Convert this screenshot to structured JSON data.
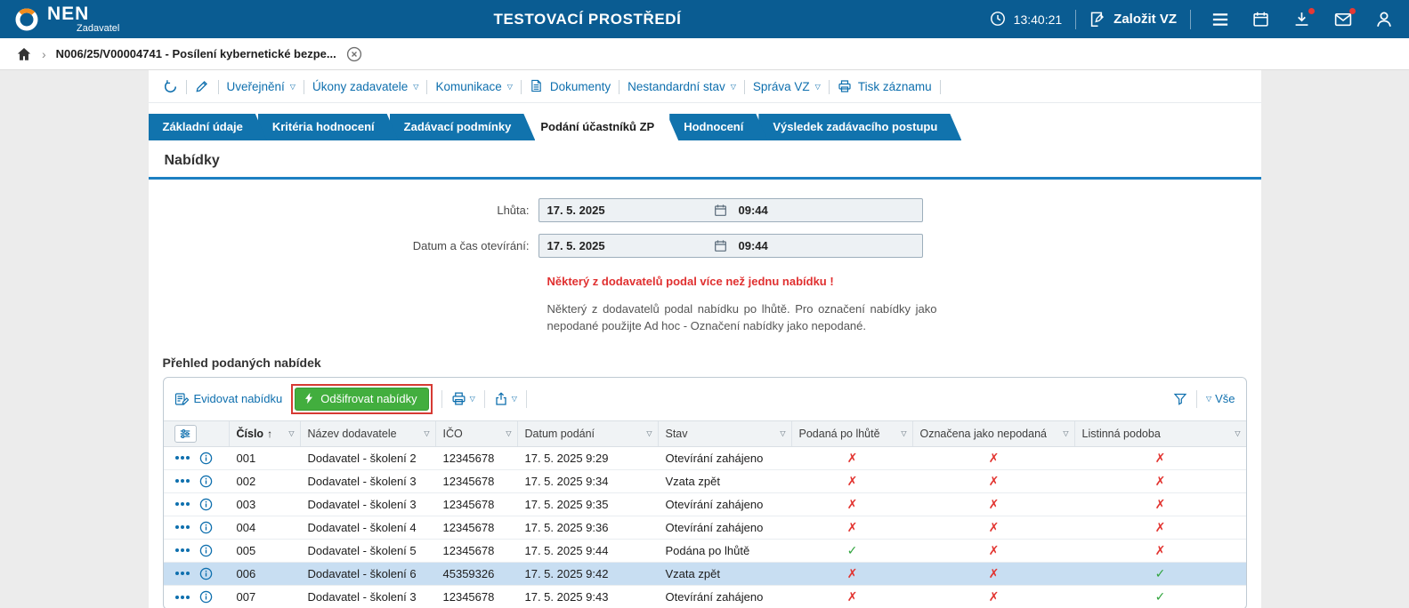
{
  "colors": {
    "topbar": "#0a5c92",
    "accent_blue": "#0e6fae",
    "tab_blue": "#1173ad",
    "section_line": "#1d80c2",
    "green_check": "#2fa43c",
    "red_cross": "#e2322e",
    "green_button": "#42ae3e",
    "highlight_outline": "#d63a33",
    "selected_row": "#c8def2"
  },
  "icons": {
    "dropdown": "▽",
    "sort_asc": "↑",
    "check": "✓",
    "cross": "✗",
    "chevron": "›"
  },
  "topbar": {
    "logo": "NEN",
    "logo_sub": "Zadavatel",
    "title": "TESTOVACÍ PROSTŘEDÍ",
    "time": "13:40:21",
    "create_button": "Založit VZ"
  },
  "breadcrumb": {
    "item": "N006/25/V00004741 - Posílení kybernetické bezpe..."
  },
  "menubar": {
    "items": [
      {
        "label": "Uveřejnění",
        "dropdown": true
      },
      {
        "label": "Úkony zadavatele",
        "dropdown": true
      },
      {
        "label": "Komunikace",
        "dropdown": true
      },
      {
        "label": "Dokumenty",
        "dropdown": false
      },
      {
        "label": "Nestandardní stav",
        "dropdown": true
      },
      {
        "label": "Správa VZ",
        "dropdown": true
      },
      {
        "label": "Tisk záznamu",
        "dropdown": false
      }
    ]
  },
  "tabs": [
    {
      "label": "Základní údaje",
      "active": false
    },
    {
      "label": "Kritéria hodnocení",
      "active": false
    },
    {
      "label": "Zadávací podmínky",
      "active": false
    },
    {
      "label": "Podání účastníků ZP",
      "active": true
    },
    {
      "label": "Hodnocení",
      "active": false
    },
    {
      "label": "Výsledek zadávacího postupu",
      "active": false
    }
  ],
  "section": {
    "title": "Nabídky"
  },
  "form": {
    "fields": [
      {
        "label": "Lhůta:",
        "date": "17. 5. 2025",
        "time": "09:44"
      },
      {
        "label": "Datum a čas otevírání:",
        "date": "17. 5. 2025",
        "time": "09:44"
      }
    ],
    "warning": "Některý z dodavatelů podal více než jednu nabídku !",
    "info": "Některý z dodavatelů podal nabídku po lhůtě. Pro označení nabídky jako nepodané použijte Ad hoc - Označení nabídky jako nepodané."
  },
  "offers": {
    "title": "Přehled podaných nabídek",
    "actions": {
      "register": "Evidovat nabídku",
      "decrypt": "Odšifrovat nabídky",
      "filter_all": "Vše"
    },
    "columns": [
      "Číslo",
      "Název dodavatele",
      "IČO",
      "Datum podání",
      "Stav",
      "Podaná po lhůtě",
      "Označena jako nepodaná",
      "Listinná podoba"
    ],
    "rows": [
      {
        "cislo": "001",
        "dodavatel": "Dodavatel - školení 2",
        "ico": "12345678",
        "datum": "17. 5. 2025 9:29",
        "stav": "Otevírání zahájeno",
        "po_lhute": false,
        "nepodana": false,
        "listinna": false,
        "selected": false
      },
      {
        "cislo": "002",
        "dodavatel": "Dodavatel - školení 3",
        "ico": "12345678",
        "datum": "17. 5. 2025 9:34",
        "stav": "Vzata zpět",
        "po_lhute": false,
        "nepodana": false,
        "listinna": false,
        "selected": false
      },
      {
        "cislo": "003",
        "dodavatel": "Dodavatel - školení 3",
        "ico": "12345678",
        "datum": "17. 5. 2025 9:35",
        "stav": "Otevírání zahájeno",
        "po_lhute": false,
        "nepodana": false,
        "listinna": false,
        "selected": false
      },
      {
        "cislo": "004",
        "dodavatel": "Dodavatel - školení 4",
        "ico": "12345678",
        "datum": "17. 5. 2025 9:36",
        "stav": "Otevírání zahájeno",
        "po_lhute": false,
        "nepodana": false,
        "listinna": false,
        "selected": false
      },
      {
        "cislo": "005",
        "dodavatel": "Dodavatel - školení 5",
        "ico": "12345678",
        "datum": "17. 5. 2025 9:44",
        "stav": "Podána po lhůtě",
        "po_lhute": true,
        "nepodana": false,
        "listinna": false,
        "selected": false
      },
      {
        "cislo": "006",
        "dodavatel": "Dodavatel - školení 6",
        "ico": "45359326",
        "datum": "17. 5. 2025 9:42",
        "stav": "Vzata zpět",
        "po_lhute": false,
        "nepodana": false,
        "listinna": true,
        "selected": true
      },
      {
        "cislo": "007",
        "dodavatel": "Dodavatel - školení 3",
        "ico": "12345678",
        "datum": "17. 5. 2025 9:43",
        "stav": "Otevírání zahájeno",
        "po_lhute": false,
        "nepodana": false,
        "listinna": true,
        "selected": false
      }
    ]
  }
}
